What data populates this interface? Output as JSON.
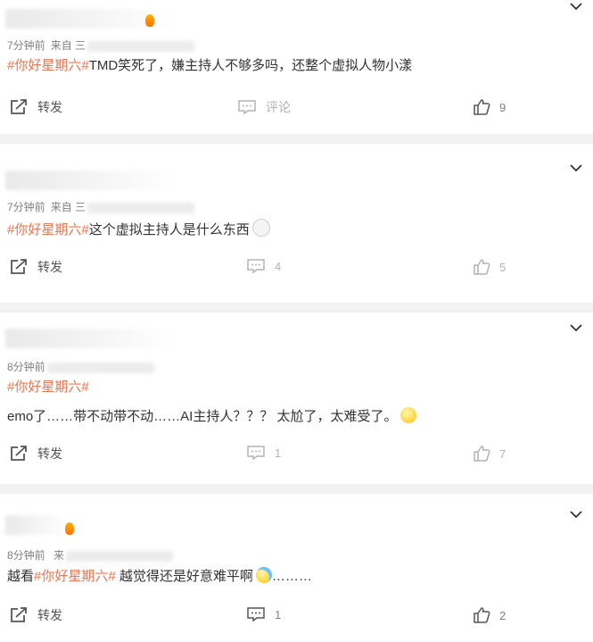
{
  "posts": [
    {
      "meta_time": "7分钟前",
      "meta_source": "来自",
      "meta_source_trail": "三",
      "topic": "#你好星期六#",
      "body": "TMD笑死了，嫌主持人不够多吗，还整个虚拟人物小漾",
      "repost_label": "转发",
      "comment_label": "评论",
      "like_count": "9"
    },
    {
      "meta_time": "7分钟前",
      "meta_source": "来自",
      "meta_source_trail": "三",
      "topic": "#你好星期六#",
      "body": "这个虚拟主持人是什么东西",
      "repost_label": "转发",
      "comment_count": "4",
      "like_count": "5"
    },
    {
      "meta_time": "8分钟前",
      "topic": "#你好星期六#",
      "body": "emo了……带不动带不动……AI主持人？？？ 太尬了，太难受了。",
      "repost_label": "转发",
      "comment_count": "1",
      "like_count": "7"
    },
    {
      "meta_time": "8分钟前",
      "meta_source_trail": "来",
      "body_prefix": "越看",
      "topic": "#你好星期六#",
      "body": " 越觉得还是好意难平啊",
      "body_suffix": "………",
      "repost_label": "转发",
      "comment_count": "1",
      "like_count": "2"
    }
  ],
  "colors": {
    "topic": "#eb7350",
    "meta": "#808080",
    "text": "#333333"
  }
}
